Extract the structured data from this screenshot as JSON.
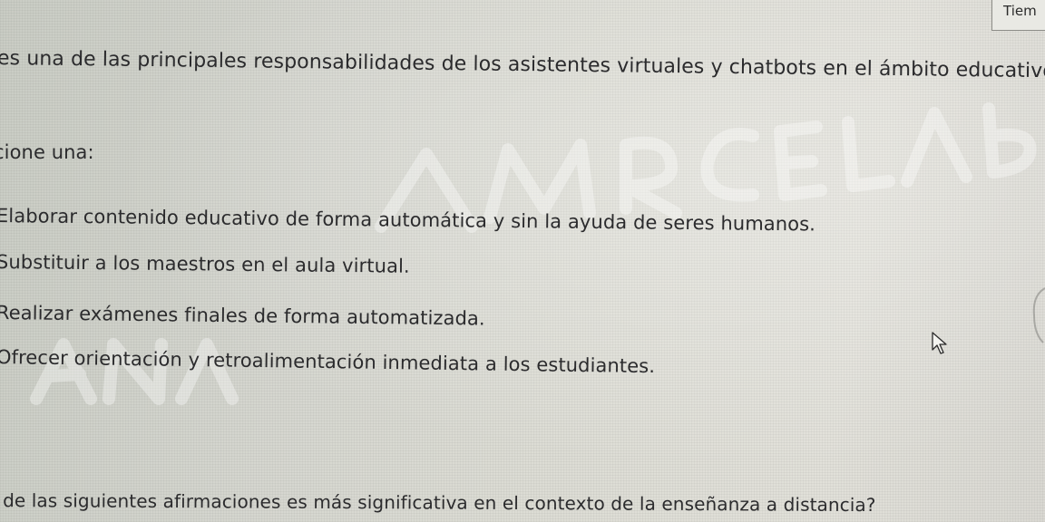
{
  "timer": {
    "label": "Tiem"
  },
  "question1": {
    "text": "es una de las principales responsabilidades de los asistentes virtuales y chatbots en el ámbito educativo?"
  },
  "instruction": {
    "text": "cione una:"
  },
  "options": [
    {
      "text": "Elaborar contenido educativo de forma automática y sin la ayuda de seres humanos."
    },
    {
      "text": "Substituir a los maestros en el aula virtual."
    },
    {
      "text": "Realizar exámenes finales de forma automatizada."
    },
    {
      "text": "Ofrecer orientación y retroalimentación inmediata a los estudiantes."
    }
  ],
  "question2": {
    "text": "l de las siguientes afirmaciones es más significativa en el contexto de la enseñanza a distancia?"
  },
  "colors": {
    "text": "#2b2b2d",
    "background": "#dcdcd4",
    "watermark": "#ffffff"
  },
  "icons": {
    "pointer": "mouse-pointer-icon"
  }
}
